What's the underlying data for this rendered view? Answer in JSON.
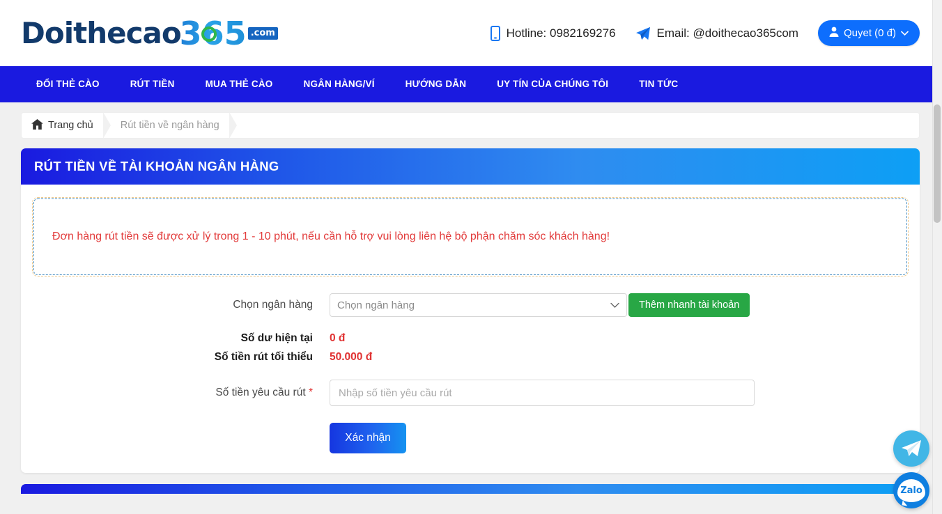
{
  "header": {
    "logo": {
      "part1": "Doithecao",
      "part2": "365",
      "suffix": ".com"
    },
    "hotline_label": "Hotline: 0982169276",
    "hotline_icon": "mobile-phone-icon",
    "email_label": "Email: @doithecao365com",
    "email_icon": "paper-plane-icon",
    "account_label": "Quyet (0 đ)",
    "account_icon": "user-icon",
    "account_caret_icon": "chevron-down-icon"
  },
  "nav": {
    "items": [
      {
        "label": "ĐỔI THẺ CÀO"
      },
      {
        "label": "RÚT TIỀN"
      },
      {
        "label": "MUA THẺ CÀO"
      },
      {
        "label": "NGÂN HÀNG/VÍ"
      },
      {
        "label": "HƯỚNG DẪN"
      },
      {
        "label": "UY TÍN CỦA CHÚNG TÔI"
      },
      {
        "label": "TIN TỨC"
      }
    ]
  },
  "breadcrumb": {
    "home_icon": "home-icon",
    "home": "Trang chủ",
    "current": "Rút tiền về ngân hàng"
  },
  "panel": {
    "title": "RÚT TIỀN VỀ TÀI KHOẢN NGÂN HÀNG",
    "alert": "Đơn hàng rút tiền sẽ được xử lý trong 1 - 10 phút, nếu cần hỗ trợ vui lòng liên hệ bộ phận chăm sóc khách hàng!"
  },
  "form": {
    "bank_label": "Chọn ngân hàng",
    "bank_selected": "Chọn ngân hàng",
    "bank_caret_icon": "chevron-down-icon",
    "add_account_button": "Thêm nhanh tài khoản",
    "balance_label": "Số dư hiện tại",
    "balance_value": "0 đ",
    "min_label": "Số tiền rút tối thiểu",
    "min_value": "50.000 đ",
    "amount_label": "Số tiền yêu cầu rút",
    "amount_required_mark": "*",
    "amount_placeholder": "Nhập số tiền yêu cầu rút",
    "amount_value": "",
    "submit_button": "Xác nhận"
  },
  "floating": {
    "telegram_icon": "telegram-icon",
    "zalo_icon": "zalo-icon",
    "zalo_label": "Zalo"
  },
  "colors": {
    "brand_blue": "#1a1ae0",
    "accent_blue": "#0d9ff5",
    "green": "#28a745",
    "red": "#e03131"
  }
}
